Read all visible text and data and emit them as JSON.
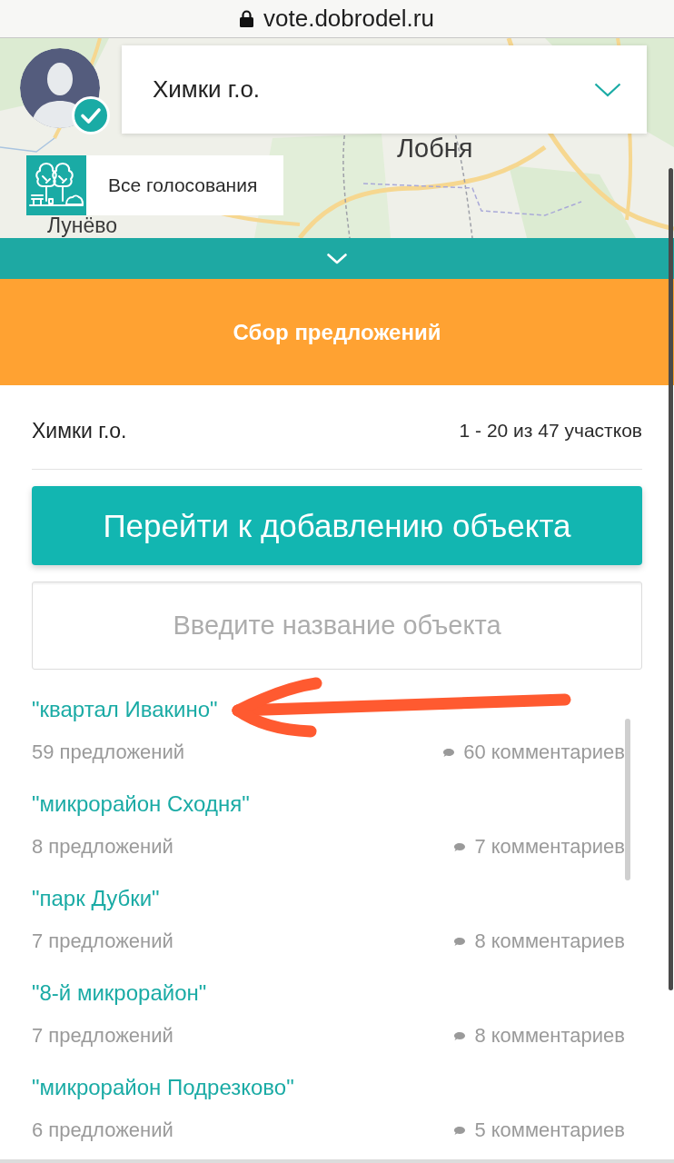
{
  "browser": {
    "url": "vote.dobrodel.ru"
  },
  "map": {
    "labels": [
      "Лобня",
      "Лунёво"
    ]
  },
  "user": {
    "verified": true
  },
  "region_select": {
    "value": "Химки г.о."
  },
  "category": {
    "label": "Все голосования"
  },
  "stage": {
    "title": "Сбор предложений"
  },
  "summary": {
    "region": "Химки г.о.",
    "range": "1 - 20 из 47 участков"
  },
  "add_button": {
    "label": "Перейти к добавлению объекта"
  },
  "search": {
    "placeholder": "Введите название объекта"
  },
  "objects": [
    {
      "name": "\"квартал Ивакино\"",
      "proposals": "59 предложений",
      "comments": "60 комментариев"
    },
    {
      "name": "\"микрорайон Сходня\"",
      "proposals": "8 предложений",
      "comments": "7 комментариев"
    },
    {
      "name": "\"парк Дубки\"",
      "proposals": "7 предложений",
      "comments": "8 комментариев"
    },
    {
      "name": "\"8-й микрорайон\"",
      "proposals": "7 предложений",
      "comments": "8 комментариев"
    },
    {
      "name": "\"микрорайон Подрезково\"",
      "proposals": "6 предложений",
      "comments": "5 комментариев"
    }
  ]
}
